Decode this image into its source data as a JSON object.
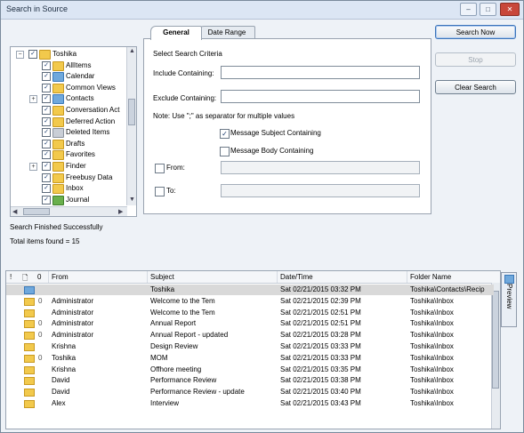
{
  "window": {
    "title": "Search in Source"
  },
  "tree": {
    "items": [
      {
        "label": "Toshika",
        "icon": "folder",
        "level": 0,
        "expander": "−"
      },
      {
        "label": "AllItems",
        "icon": "folder",
        "level": 1,
        "expander": ""
      },
      {
        "label": "Calendar",
        "icon": "blue",
        "level": 1,
        "expander": ""
      },
      {
        "label": "Common Views",
        "icon": "folder",
        "level": 1,
        "expander": ""
      },
      {
        "label": "Contacts",
        "icon": "blue",
        "level": 1,
        "expander": "+"
      },
      {
        "label": "Conversation Act",
        "icon": "folder",
        "level": 1,
        "expander": ""
      },
      {
        "label": "Deferred Action",
        "icon": "folder",
        "level": 1,
        "expander": ""
      },
      {
        "label": "Deleted Items",
        "icon": "gray",
        "level": 1,
        "expander": ""
      },
      {
        "label": "Drafts",
        "icon": "folder",
        "level": 1,
        "expander": ""
      },
      {
        "label": "Favorites",
        "icon": "folder",
        "level": 1,
        "expander": ""
      },
      {
        "label": "Finder",
        "icon": "folder",
        "level": 1,
        "expander": "+"
      },
      {
        "label": "Freebusy Data",
        "icon": "folder",
        "level": 1,
        "expander": ""
      },
      {
        "label": "Inbox",
        "icon": "folder",
        "level": 1,
        "expander": ""
      },
      {
        "label": "Journal",
        "icon": "green",
        "level": 1,
        "expander": ""
      }
    ]
  },
  "tabs": {
    "general": "General",
    "date_range": "Date Range"
  },
  "criteria": {
    "heading": "Select Search Criteria",
    "include_label": "Include Containing:",
    "include_value": "",
    "exclude_label": "Exclude Containing:",
    "exclude_value": "",
    "note": "Note: Use \";\" as separator for multiple values",
    "subject_label": "Message Subject Containing",
    "subject_checked": "✓",
    "body_label": "Message Body Containing",
    "from_label": "From:",
    "to_label": "To:"
  },
  "buttons": {
    "search_now": "Search Now",
    "stop": "Stop",
    "clear_search": "Clear Search"
  },
  "status": {
    "message": "Search Finished Successfully",
    "total": "Total items found = 15"
  },
  "results": {
    "headers": {
      "flag": "!",
      "type": "🗋",
      "attach": "0",
      "from": "From",
      "subject": "Subject",
      "date": "Date/Time",
      "folder": "Folder Name"
    },
    "rows": [
      {
        "icon": "contact",
        "attach": "",
        "from": "",
        "subject": "Toshika",
        "date": "Sat 02/21/2015 03:32 PM",
        "folder": "Toshika\\Contacts\\Recip"
      },
      {
        "icon": "mail",
        "attach": "0",
        "from": "Administrator",
        "subject": "Welcome to the Tem",
        "date": "Sat 02/21/2015 02:39 PM",
        "folder": "Toshika\\Inbox"
      },
      {
        "icon": "mail",
        "attach": "",
        "from": "Administrator",
        "subject": "Welcome to the Tem",
        "date": "Sat 02/21/2015 02:51 PM",
        "folder": "Toshika\\Inbox"
      },
      {
        "icon": "mail",
        "attach": "0",
        "from": "Administrator",
        "subject": "Annual Report",
        "date": "Sat 02/21/2015 02:51 PM",
        "folder": "Toshika\\Inbox"
      },
      {
        "icon": "mail",
        "attach": "0",
        "from": "Administrator",
        "subject": "Annual Report - updated",
        "date": "Sat 02/21/2015 03:28 PM",
        "folder": "Toshika\\Inbox"
      },
      {
        "icon": "mail",
        "attach": "",
        "from": "Krishna",
        "subject": "Design Review",
        "date": "Sat 02/21/2015 03:33 PM",
        "folder": "Toshika\\Inbox"
      },
      {
        "icon": "mail",
        "attach": "0",
        "from": "Toshika",
        "subject": "MOM",
        "date": "Sat 02/21/2015 03:33 PM",
        "folder": "Toshika\\Inbox"
      },
      {
        "icon": "mail",
        "attach": "",
        "from": "Krishna",
        "subject": "Offhore meeting",
        "date": "Sat 02/21/2015 03:35 PM",
        "folder": "Toshika\\Inbox"
      },
      {
        "icon": "mail",
        "attach": "",
        "from": "David",
        "subject": "Performance Review",
        "date": "Sat 02/21/2015 03:38 PM",
        "folder": "Toshika\\Inbox"
      },
      {
        "icon": "mail",
        "attach": "",
        "from": "David",
        "subject": "Performance Review - update",
        "date": "Sat 02/21/2015 03:40 PM",
        "folder": "Toshika\\Inbox"
      },
      {
        "icon": "mail",
        "attach": "",
        "from": "Alex",
        "subject": "Interview",
        "date": "Sat 02/21/2015 03:43 PM",
        "folder": "Toshika\\Inbox"
      }
    ]
  },
  "preview": {
    "label": "Preview"
  }
}
